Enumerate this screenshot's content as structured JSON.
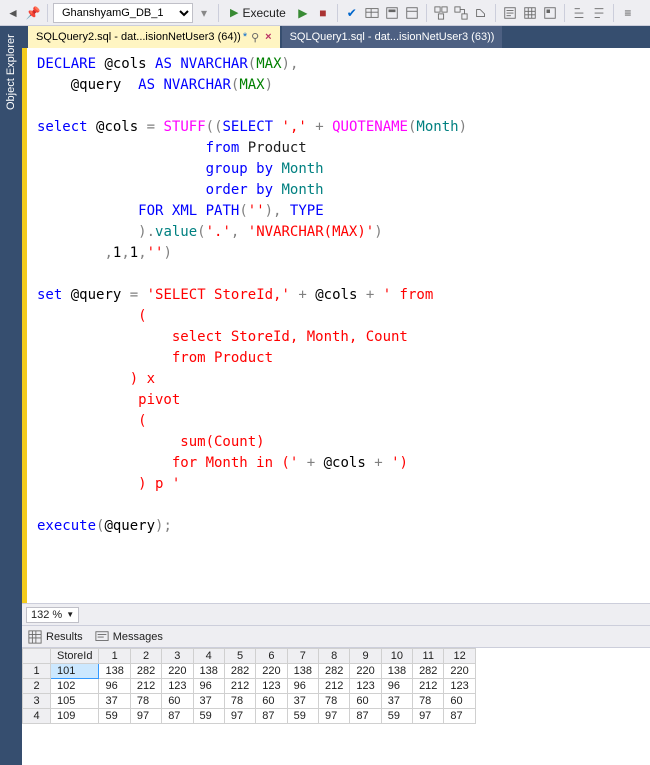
{
  "toolbar": {
    "database": "GhanshyamG_DB_1",
    "execute_label": "Execute"
  },
  "side": {
    "object_explorer": "Object Explorer"
  },
  "tabs": [
    {
      "label": "SQLQuery2.sql - dat...isionNetUser3 (64))",
      "modified": true,
      "active": true
    },
    {
      "label": "SQLQuery1.sql - dat...isionNetUser3 (63))",
      "modified": false,
      "active": false
    }
  ],
  "zoom": "132 %",
  "result_tabs": {
    "results": "Results",
    "messages": "Messages"
  },
  "results": {
    "columns": [
      "StoreId",
      "1",
      "2",
      "3",
      "4",
      "5",
      "6",
      "7",
      "8",
      "9",
      "10",
      "11",
      "12"
    ],
    "rows": [
      [
        "101",
        "138",
        "282",
        "220",
        "138",
        "282",
        "220",
        "138",
        "282",
        "220",
        "138",
        "282",
        "220"
      ],
      [
        "102",
        "96",
        "212",
        "123",
        "96",
        "212",
        "123",
        "96",
        "212",
        "123",
        "96",
        "212",
        "123"
      ],
      [
        "105",
        "37",
        "78",
        "60",
        "37",
        "78",
        "60",
        "37",
        "78",
        "60",
        "37",
        "78",
        "60"
      ],
      [
        "109",
        "59",
        "97",
        "87",
        "59",
        "97",
        "87",
        "59",
        "97",
        "87",
        "59",
        "97",
        "87"
      ]
    ]
  },
  "code": {
    "l1a": "DECLARE",
    "l1b": "@cols",
    "l1c": "AS",
    "l1d": "NVARCHAR",
    "l1e": "MAX",
    "l2a": "@query",
    "l2b": "AS",
    "l2c": "NVARCHAR",
    "l2d": "MAX",
    "l3a": "select",
    "l3b": "@cols",
    "l3c": "STUFF",
    "l3d": "SELECT",
    "l3e": "','",
    "l3f": "QUOTENAME",
    "l3g": "Month",
    "l4a": "from",
    "l4b": "Product",
    "l5a": "group",
    "l5b": "by",
    "l5c": "Month",
    "l6a": "order",
    "l6b": "by",
    "l6c": "Month",
    "l7a": "FOR",
    "l7b": "XML PATH",
    "l7c": "''",
    "l7d": "TYPE",
    "l8a": "value",
    "l8b": "'.'",
    "l8c": "'NVARCHAR(MAX)'",
    "l9a": "1",
    "l9b": "1",
    "l9c": "''",
    "l10a": "set",
    "l10b": "@query",
    "l10c": "'SELECT StoreId,'",
    "l10d": "@cols",
    "l10e": "' from ",
    "l11": "            (",
    "l12": "                select StoreId, Month, Count",
    "l13": "                from Product",
    "l14": "           ) x",
    "l15": "            pivot ",
    "l16": "            (",
    "l17": "                 sum(Count)",
    "l18a": "                for Month in ('",
    "l18b": "@cols",
    "l18c": "')",
    "l19": "            ) p '",
    "l20a": "execute",
    "l20b": "@query"
  }
}
